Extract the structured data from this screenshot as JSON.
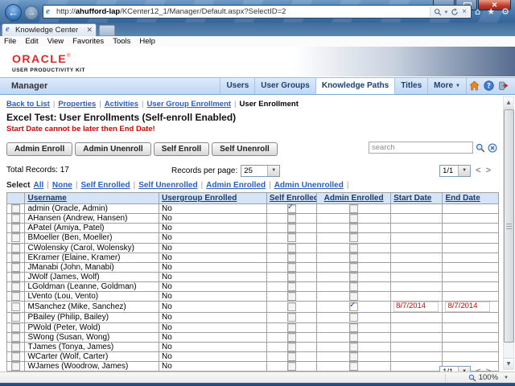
{
  "browser": {
    "url_prefix": "http://",
    "url_host": "ahufford-lap",
    "url_path": "/KCenter12_1/Manager/Default.aspx?SelectID=2",
    "tab_title": "Knowledge Center",
    "menu": [
      "File",
      "Edit",
      "View",
      "Favorites",
      "Tools",
      "Help"
    ],
    "zoom_level": "100%"
  },
  "brand": {
    "logo": "ORACLE",
    "tagline": "USER PRODUCTIVITY KIT"
  },
  "manager_bar": {
    "title": "Manager",
    "tabs": [
      {
        "label": "Users",
        "active": false,
        "dropdown": false
      },
      {
        "label": "User Groups",
        "active": false,
        "dropdown": false
      },
      {
        "label": "Knowledge Paths",
        "active": true,
        "dropdown": false
      },
      {
        "label": "Titles",
        "active": false,
        "dropdown": false
      },
      {
        "label": "More",
        "active": false,
        "dropdown": true
      }
    ]
  },
  "breadcrumb": {
    "links": [
      "Back to List",
      "Properties",
      "Activities",
      "User Group Enrollment"
    ],
    "current": "User Enrollment"
  },
  "page": {
    "title": "Excel Test: User Enrollments (Self-enroll Enabled)",
    "warning": "Start Date cannot be later then End Date!"
  },
  "toolbar": {
    "buttons": [
      "Admin Enroll",
      "Admin Unenroll",
      "Self Enroll",
      "Self Unenroll"
    ],
    "search_placeholder": "search"
  },
  "records": {
    "total": "Total Records: 17",
    "per_page_label": "Records per page:",
    "per_page_value": "25",
    "page_indicator": "1/1"
  },
  "select_bar": {
    "label": "Select",
    "links": [
      "All",
      "None",
      "Self Enrolled",
      "Self Unenrolled",
      "Admin Enrolled",
      "Admin Unenrolled"
    ]
  },
  "table": {
    "columns": [
      "Username",
      "Usergroup Enrolled",
      "Self Enrolled",
      "Admin Enrolled",
      "Start Date",
      "End Date"
    ],
    "rows": [
      {
        "username": "admin (Oracle, Admin)",
        "usergroup": "No",
        "self_enrolled": true,
        "admin_enrolled": false,
        "start": "",
        "end": ""
      },
      {
        "username": "AHansen (Andrew, Hansen)",
        "usergroup": "No",
        "self_enrolled": false,
        "admin_enrolled": false,
        "start": "",
        "end": ""
      },
      {
        "username": "APatel (Amiya, Patel)",
        "usergroup": "No",
        "self_enrolled": false,
        "admin_enrolled": false,
        "start": "",
        "end": ""
      },
      {
        "username": "BMoeller (Ben, Moeller)",
        "usergroup": "No",
        "self_enrolled": false,
        "admin_enrolled": false,
        "start": "",
        "end": ""
      },
      {
        "username": "CWolensky (Carol, Wolensky)",
        "usergroup": "No",
        "self_enrolled": false,
        "admin_enrolled": false,
        "start": "",
        "end": ""
      },
      {
        "username": "EKramer (Elaine, Kramer)",
        "usergroup": "No",
        "self_enrolled": false,
        "admin_enrolled": false,
        "start": "",
        "end": ""
      },
      {
        "username": "JManabi (John, Manabi)",
        "usergroup": "No",
        "self_enrolled": false,
        "admin_enrolled": false,
        "start": "",
        "end": ""
      },
      {
        "username": "JWolf (James, Wolf)",
        "usergroup": "No",
        "self_enrolled": false,
        "admin_enrolled": false,
        "start": "",
        "end": ""
      },
      {
        "username": "LGoldman (Leanne, Goldman)",
        "usergroup": "No",
        "self_enrolled": false,
        "admin_enrolled": false,
        "start": "",
        "end": ""
      },
      {
        "username": "LVento (Lou, Vento)",
        "usergroup": "No",
        "self_enrolled": false,
        "admin_enrolled": false,
        "start": "",
        "end": ""
      },
      {
        "username": "MSanchez (Mike, Sanchez)",
        "usergroup": "No",
        "self_enrolled": false,
        "admin_enrolled": true,
        "start": "8/7/2014",
        "end": "8/7/2014"
      },
      {
        "username": "PBailey (Philip, Bailey)",
        "usergroup": "No",
        "self_enrolled": false,
        "admin_enrolled": false,
        "start": "",
        "end": ""
      },
      {
        "username": "PWold (Peter, Wold)",
        "usergroup": "No",
        "self_enrolled": false,
        "admin_enrolled": false,
        "start": "",
        "end": ""
      },
      {
        "username": "SWong (Susan, Wong)",
        "usergroup": "No",
        "self_enrolled": false,
        "admin_enrolled": false,
        "start": "",
        "end": ""
      },
      {
        "username": "TJames (Tonya, James)",
        "usergroup": "No",
        "self_enrolled": false,
        "admin_enrolled": false,
        "start": "",
        "end": ""
      },
      {
        "username": "WCarter (Wolf, Carter)",
        "usergroup": "No",
        "self_enrolled": false,
        "admin_enrolled": false,
        "start": "",
        "end": ""
      },
      {
        "username": "WJames (Woodrow, James)",
        "usergroup": "No",
        "self_enrolled": false,
        "admin_enrolled": false,
        "start": "",
        "end": ""
      }
    ]
  },
  "colors": {
    "oracle_red": "#e02826",
    "link_blue": "#2b5cc4",
    "warning_red": "#e00000",
    "header_blue": "#d5e4f6",
    "chrome_blue": "#4a7cb2"
  }
}
